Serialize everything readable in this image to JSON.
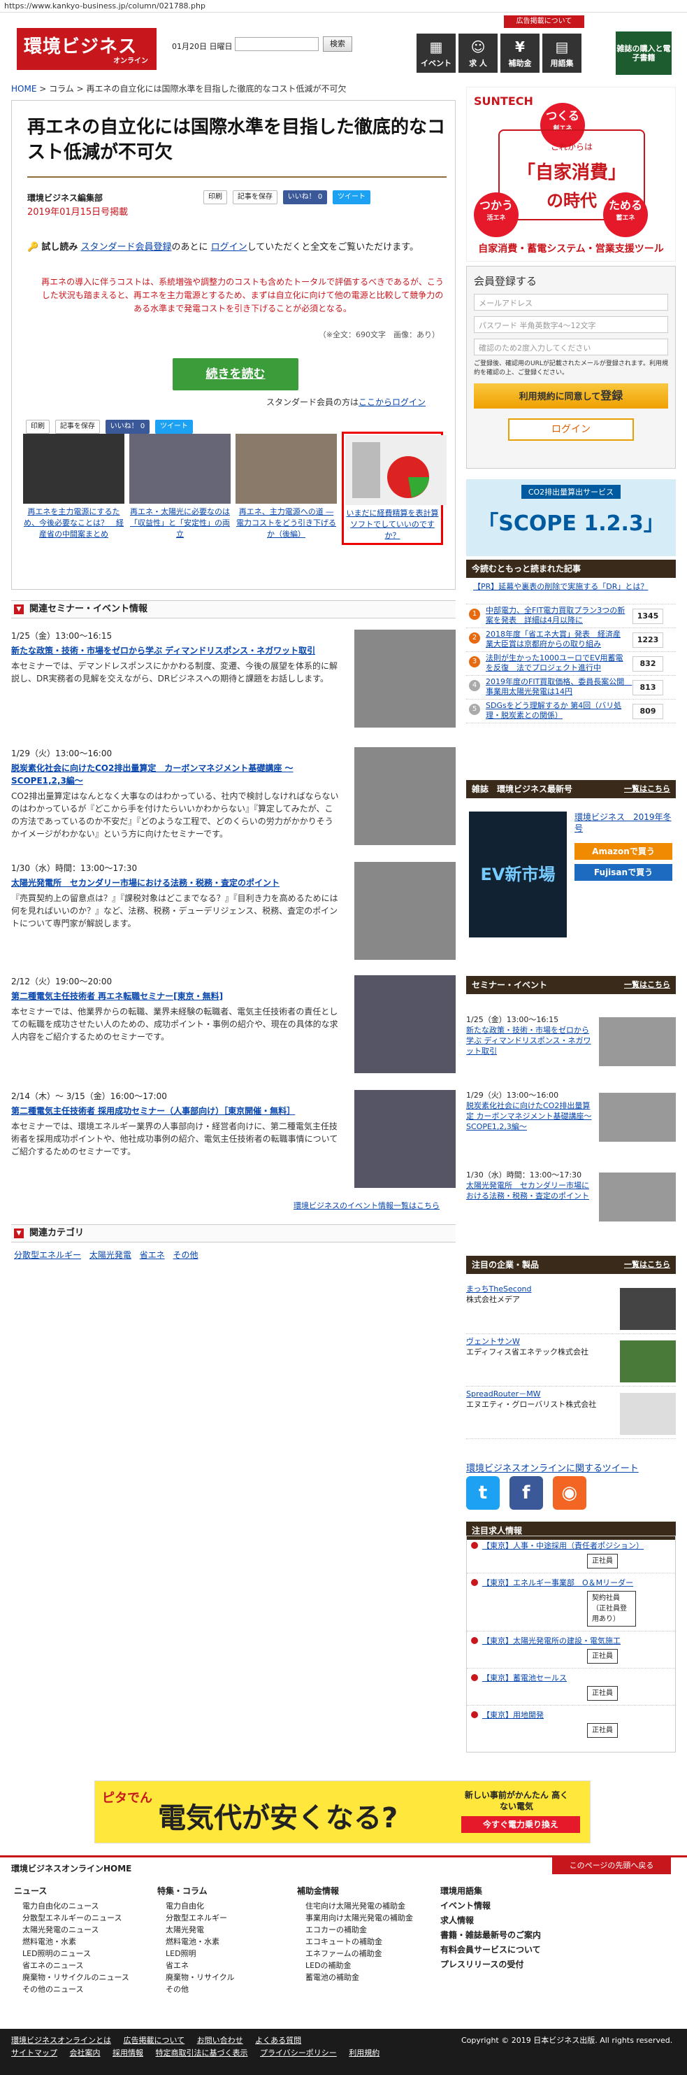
{
  "browser": {
    "url": "https://www.kankyo-business.jp/column/021788.php"
  },
  "header": {
    "logo_main": "環境ビジネス",
    "logo_sub": "オンライン",
    "date": "01月20日 日曜日",
    "search_btn": "検索",
    "ad_link": "広告掲載について",
    "nav": [
      {
        "label": "イベント",
        "icon": "calendar-icon"
      },
      {
        "label": "求 人",
        "icon": "person-icon"
      },
      {
        "label": "補助金",
        "icon": "yen-icon"
      },
      {
        "label": "用語集",
        "icon": "book-icon"
      }
    ],
    "banner": "雑誌の購入と電子書籍"
  },
  "breadcrumb": {
    "home": "HOME",
    "sep": ">",
    "col": "コラム",
    "current": "再エネの自立化には国際水準を目指した徹底的なコスト低減が不可欠"
  },
  "article": {
    "title": "再エネの自立化には国際水準を目指した徹底的なコスト低減が不可欠",
    "author": "環境ビジネス編集部",
    "date": "2019年01月15日号掲載",
    "print": "印刷",
    "save": "記事を保存",
    "like": "いいね！ 0",
    "tweet": "ツイート",
    "trial_label": "試し読み",
    "trial_text_1": "スタンダード会員登録",
    "trial_text_2": "のあとに",
    "trial_text_3": "ログイン",
    "trial_text_4": "していただくと全文をご覧いただけます。",
    "notice": "再エネの導入に伴うコストは、系統増強や調整力のコストも含めたトータルで評価するべきであるが、こうした状況も踏まえると、再エネを主力電源とするため、まずは自立化に向けて他の電源と比較して競争力のある水準まで発電コストを引き下げることが必須となる。",
    "chars": "（※全文：690文字　画像：あり）",
    "read_more": "続きを読む",
    "std_text": "スタンダード会員の方は",
    "std_link": "ここからログイン",
    "thumbs": [
      {
        "cap": "再エネを主力電源にするため、今後必要なことは？　経産省の中間案まとめ"
      },
      {
        "cap": "再エネ・太陽光に必要なのは「収益性」と「安定性」の両立"
      },
      {
        "cap": "再エネ、主力電源への道 ― 電力コストをどう引き下げるか（後編）"
      },
      {
        "cap": "いまだに経費精算を表計算ソフトでしていいのですか？"
      }
    ]
  },
  "events": {
    "heading": "関連セミナー・イベント情報",
    "items": [
      {
        "date": "1/25（金）13:00～16:15",
        "title": "新たな政策・技術・市場をゼロから学ぶ ディマンドリスポンス・ネガワット取引",
        "body": "本セミナーでは、デマンドレスポンスにかかわる制度、変遷、今後の展望を体系的に解説し、DR実務者の見解を交えながら、DRビジネスへの期待と課題をお話しします。"
      },
      {
        "date": "1/29（火）13:00～16:00",
        "title": "脱炭素化社会に向けたCO2排出量算定　カーボンマネジメント基礎講座 ～SCOPE1,2,3編～",
        "body": "CO2排出量算定はなんとなく大事なのはわかっている、社内で検討しなければならないのはわかっているが『どこから手を付けたらいいかわからない』『算定してみたが、この方法であっているのか不安だ』『どのような工程で、どのくらいの労力がかかりそうかイメージがわかない』という方に向けたセミナーです。"
      },
      {
        "date": "1/30（水）時間：13:00～17:30",
        "title": "太陽光発電所　セカンダリー市場における法務・税務・査定のポイント",
        "body": "『売買契約上の留意点は？』『課税対象はどこまでなる？』『目利き力を高めるためには何を見ればいいのか？』など、法務、税務・デューデリジェンス、税務、査定のポイントについて専門家が解説します。"
      },
      {
        "date": "2/12（火）19:00～20:00",
        "title": "第二種電気主任技術者 再エネ転職セミナー[東京・無料]",
        "body": "本セミナーでは、他業界からの転職、業界未経験の転職者、電気主任技術者の責任としての転職を成功させたい人のための、成功ポイント・事例の紹介や、現在の具体的な求人内容をご紹介するためのセミナーです。"
      },
      {
        "date": "2/14（木）～ 3/15（金）16:00～17:00",
        "title": "第二種電気主任技術者 採用成功セミナー（人事部向け）［東京開催・無料］",
        "body": "本セミナーでは、環境エネルギー業界の人事部向け・経営者向けに、第二種電気主任技術者を採用成功ポイントや、他社成功事例の紹介、電気主任技術者の転職事情についてご紹介するためのセミナーです。"
      }
    ],
    "more": "環境ビジネスのイベント情報一覧はこちら"
  },
  "categories": {
    "heading": "関連カテゴリ",
    "items": [
      "分散型エネルギー",
      "太陽光発電",
      "省エネ",
      "その他"
    ]
  },
  "sidebar": {
    "suntech": {
      "brand": "SUNTECH",
      "k1": "これからは",
      "k2": "「自家消費」",
      "k3": "の時代",
      "c1": "つくる",
      "c1s": "創エネ",
      "c2": "つかう",
      "c2s": "活エネ",
      "c3": "ためる",
      "c3s": "蓄エネ",
      "bottom": "自家消費・蓄電システム・営業支援ツール"
    },
    "login": {
      "heading": "会員登録する",
      "email_ph": "メールアドレス",
      "pass_ph": "パスワード 半角英数字4～12文字",
      "pass2_ph": "確認のため2度入力してください",
      "note": "ご登録後、確認用のURLが記載されたメールが登録されます。利用規約を確認の上、ご登録ください。",
      "register": "利用規約に同意して",
      "register_b": "登録",
      "login_btn": "ログイン"
    },
    "scope": {
      "s1": "CO2排出量算出サービス",
      "s2": "「SCOPE 1.2.3」"
    },
    "ranking": {
      "heading": "今読むともっと読まれた記事",
      "items": [
        {
          "n": "",
          "title": "【PR】延幕や裏表の削除で実施する「DR」とは？",
          "count": ""
        },
        {
          "n": "1",
          "title": "中部電力、全FIT電力買取プラン3つの新案を発表　詳細は4月以降に",
          "count": "1345"
        },
        {
          "n": "2",
          "title": "2018年度「省エネ大賞」発表　経済産業大臣賞は京都府からの取り組み",
          "count": "1223"
        },
        {
          "n": "3",
          "title": "法則が生かった1000ユーロでEV用蓄電を反復　法でプロジェクト進行中",
          "count": "832"
        },
        {
          "n": "4",
          "title": "2019年度のFIT買取価格、委員長案公開　事業用太陽光発電は14円",
          "count": "813"
        },
        {
          "n": "5",
          "title": "SDGsをどう理解するか 第4回（バリ処理・脱炭素との関係）",
          "count": "809"
        }
      ]
    },
    "magazine": {
      "heading": "雑誌　環境ビジネス最新号",
      "more": "一覧はこちら",
      "cover": "EV新市場",
      "info": "環境ビジネス　2019年冬号",
      "amazon": "Amazonで買う",
      "fujisan": "Fujisanで買う"
    },
    "sem": {
      "heading": "セミナー・イベント",
      "more": "一覧はこちら",
      "items": [
        {
          "date": "1/25（金）13:00～16:15",
          "title": "新たな政策・技術・市場をゼロから学ぶ ディマンドリスポンス・ネガワット取引"
        },
        {
          "date": "1/29（火）13:00～16:00",
          "title": "脱炭素化社会に向けたCO2排出量算定 カーボンマネジメント基礎講座～SCOPE1,2,3編～"
        },
        {
          "date": "1/30（水）時間：13:00～17:30",
          "title": "太陽光発電所　セカンダリー市場における法務・税務・査定のポイント"
        }
      ]
    },
    "corp": {
      "heading": "注目の企業・製品",
      "more": "一覧はこちら",
      "items": [
        {
          "title": "まっちTheSecond",
          "sub": "株式会社メデア"
        },
        {
          "title": "ヴェントサンW",
          "sub": "エディフィス省エネテック株式会社"
        },
        {
          "title": "SpreadRouter－MW",
          "sub": "エヌエティ・グローバリスト株式会社"
        }
      ]
    },
    "twitter_link": "環境ビジネスオンラインに関するツイート",
    "jobs": {
      "heading": "注目求人情報",
      "items": [
        {
          "title": "【東京】人事・中途採用（責任者ポジション）",
          "tag": "正社員"
        },
        {
          "title": "【東京】エネルギー事業部　O＆Mリーダー",
          "tag": "契約社員（正社員登用あり）"
        },
        {
          "title": "【東京】太陽光発電所の建設・電気施工",
          "tag": "正社員"
        },
        {
          "title": "【東京】蓄電池セールス",
          "tag": "正社員"
        },
        {
          "title": "【東京】用地開発",
          "tag": "正社員"
        }
      ]
    }
  },
  "ad": {
    "brand": "ピタでん",
    "main": "電気代が安くなる?",
    "side": "新しい事前がかんたん 高くない電気",
    "cta": "今すぐ電力乗り換え"
  },
  "footer": {
    "home": "環境ビジネスオンラインHOME",
    "totop": "このページの先頭へ戻る",
    "cols": [
      {
        "h": "ニュース",
        "items": [
          "電力自由化のニュース",
          "分散型エネルギーのニュース",
          "太陽光発電のニュース",
          "燃料電池・水素",
          "LED照明のニュース",
          "省エネのニュース",
          "廃棄物・リサイクルのニュース",
          "その他のニュース"
        ]
      },
      {
        "h": "特集・コラム",
        "items": [
          "電力自由化",
          "分散型エネルギー",
          "太陽光発電",
          "燃料電池・水素",
          "LED照明",
          "省エネ",
          "廃棄物・リサイクル",
          "その他"
        ]
      },
      {
        "h": "補助金情報",
        "items": [
          "住宅向け太陽光発電の補助金",
          "事業用向け太陽光発電の補助金",
          "エコカーの補助金",
          "エコキュートの補助金",
          "エネファームの補助金",
          "LEDの補助金",
          "蓄電池の補助金"
        ]
      },
      {
        "h": "環境用語集",
        "items": [
          "イベント情報",
          "求人情報",
          "書籍・雑誌最新号のご案内",
          "有料会員サービスについて",
          "プレスリリースの受付"
        ]
      }
    ],
    "links": [
      "環境ビジネスオンラインとは",
      "広告掲載について",
      "お問い合わせ",
      "よくある質問",
      "サイトマップ",
      "会社案内",
      "採用情報",
      "特定商取引法に基づく表示",
      "プライバシーポリシー",
      "利用規約"
    ],
    "copyright": "Copyright © 2019 日本ビジネス出版. All rights reserved."
  }
}
